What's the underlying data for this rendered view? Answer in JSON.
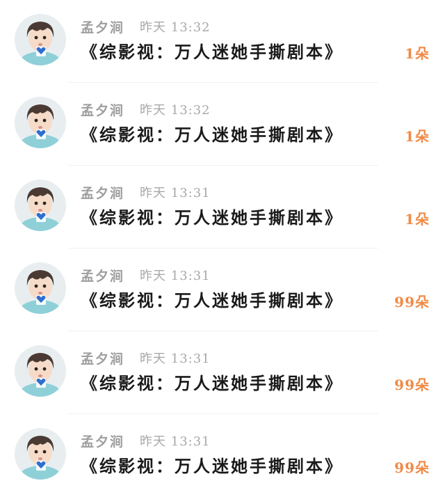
{
  "rows": [
    {
      "username": "孟夕涧",
      "time": "昨天 13:32",
      "title": "《综影视：万人迷她手撕剧本》",
      "gift": "1朵"
    },
    {
      "username": "孟夕涧",
      "time": "昨天 13:32",
      "title": "《综影视：万人迷她手撕剧本》",
      "gift": "1朵"
    },
    {
      "username": "孟夕涧",
      "time": "昨天 13:31",
      "title": "《综影视：万人迷她手撕剧本》",
      "gift": "1朵"
    },
    {
      "username": "孟夕涧",
      "time": "昨天 13:31",
      "title": "《综影视：万人迷她手撕剧本》",
      "gift": "99朵"
    },
    {
      "username": "孟夕涧",
      "time": "昨天 13:31",
      "title": "《综影视：万人迷她手撕剧本》",
      "gift": "99朵"
    },
    {
      "username": "孟夕涧",
      "time": "昨天 13:31",
      "title": "《综影视：万人迷她手撕剧本》",
      "gift": "99朵"
    }
  ],
  "colors": {
    "gift": "#f08a46",
    "meta": "#9e9e9e",
    "title": "#1a1a1a",
    "heart": "#2f6fd0"
  }
}
